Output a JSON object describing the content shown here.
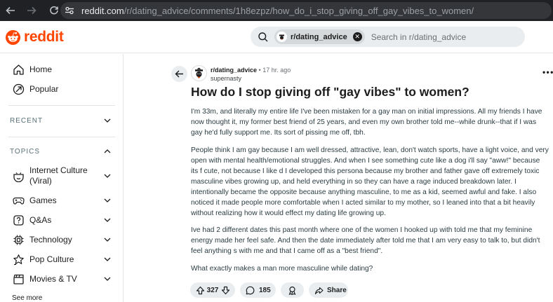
{
  "browser": {
    "url_host": "reddit.com",
    "url_path": "/r/dating_advice/comments/1h8ezpz/how_do_i_stop_giving_off_gay_vibes_to_women/",
    "icons": {
      "back": "arrow-left-icon",
      "forward": "arrow-right-icon",
      "reload": "reload-icon",
      "site": "site-settings-icon"
    }
  },
  "header": {
    "logo_text": "reddit",
    "search": {
      "chip_label": "r/dating_advice",
      "placeholder": "Search in r/dating_advice"
    },
    "colors": {
      "brand": "#ff4500",
      "search_bg": "#eaedef"
    }
  },
  "sidebar": {
    "primary": [
      {
        "label": "Home",
        "icon": "home-icon"
      },
      {
        "label": "Popular",
        "icon": "popular-icon"
      }
    ],
    "recent_heading": "RECENT",
    "topics_heading": "TOPICS",
    "topics": [
      {
        "label": "Internet Culture\n(Viral)",
        "icon": "internet-culture-icon"
      },
      {
        "label": "Games",
        "icon": "gamepad-icon"
      },
      {
        "label": "Q&As",
        "icon": "qa-icon"
      },
      {
        "label": "Technology",
        "icon": "chip-icon"
      },
      {
        "label": "Pop Culture",
        "icon": "star-icon"
      },
      {
        "label": "Movies & TV",
        "icon": "clapperboard-icon"
      }
    ],
    "see_more": "See more"
  },
  "post": {
    "subreddit": "r/dating_advice",
    "time": "17 hr. ago",
    "author": "supernasty",
    "title": "How do I stop giving off \"gay vibes\" to women?",
    "paragraphs": [
      "I'm 33m, and literally my entire life I've been mistaken for a gay man on initial impressions. All my friends I have now thought it, my former best friend of 25 years, and even my own brother told me--while drunk--that if I was gay he'd fully support me. Its sort of pissing me off, tbh.",
      "People think I am gay because I am well dressed, attractive, lean, don't watch sports, have a light voice, and very open with mental health/emotional struggles. And when I see something cute like a dog i'll say \"aww!\" because its f        cute, not because I like d       I developed this persona because my brother and father gave off extremely toxic masculine vibes growing up, and held everything in so they can have a rage induced breakdown later. I intentionally became the opposite because anything masculine, to me as a kid, seemed awful and fake. I also noticed it made people more comfortable when I acted similar to my mother, so I leaned into that a bit heavily without realizing how it would effect my dating life growing up.",
      "Ive had 2 different dates this past month where one of the women I hooked up with told me that my feminine energy made her feel safe. And then the date immediately after told me that I am very easy to talk to, but didn't feel anything s           with me and that I came off as a \"best friend\".",
      "What exactly makes a man more masculine while dating?"
    ],
    "votes": "327",
    "comments": "185",
    "share_label": "Share"
  }
}
